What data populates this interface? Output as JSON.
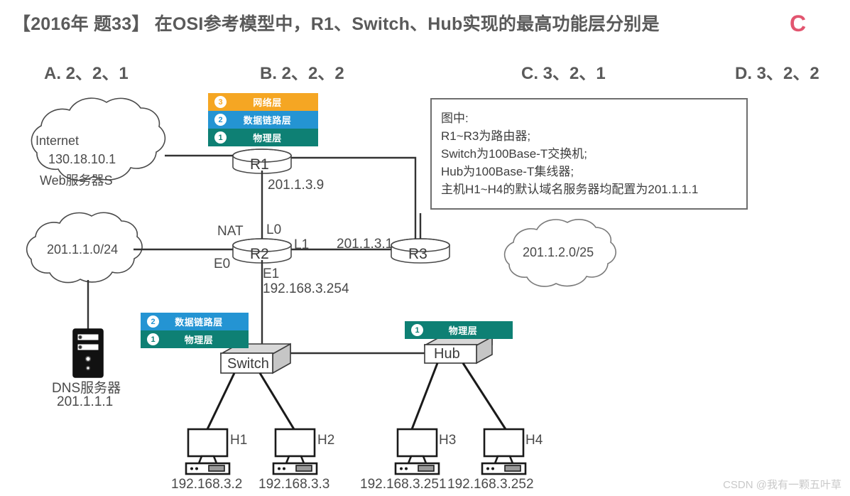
{
  "header": {
    "question": "【2016年 题33】 在OSI参考模型中，R1、Switch、Hub实现的最高功能层分别是",
    "answer_mark": "C",
    "answer_color": "#e2556f",
    "options": [
      {
        "id": "A",
        "text": "A. 2、2、1"
      },
      {
        "id": "B",
        "text": "B. 2、2、2"
      },
      {
        "id": "C",
        "text": "C. 3、2、1"
      },
      {
        "id": "D",
        "text": "D. 3、2、2"
      }
    ]
  },
  "note_box": {
    "lines": [
      "图中:",
      "R1~R3为路由器;",
      "Switch为100Base-T交换机;",
      "Hub为100Base-T集线器;",
      "主机H1~H4的默认域名服务器均配置为201.1.1.1"
    ]
  },
  "layer_stacks": {
    "r1": {
      "device": "R1",
      "rows": [
        {
          "num": "3",
          "label": "网络层",
          "color": "#f5a623"
        },
        {
          "num": "2",
          "label": "数据链路层",
          "color": "#2494d3"
        },
        {
          "num": "1",
          "label": "物理层",
          "color": "#0e8074"
        }
      ]
    },
    "switch": {
      "device": "Switch",
      "rows": [
        {
          "num": "2",
          "label": "数据链路层",
          "color": "#2494d3"
        },
        {
          "num": "1",
          "label": "物理层",
          "color": "#0e8074"
        }
      ]
    },
    "hub": {
      "device": "Hub",
      "rows": [
        {
          "num": "1",
          "label": "物理层",
          "color": "#0e8074"
        }
      ]
    }
  },
  "clouds": {
    "internet": {
      "line1": "Internet",
      "line2": "130.18.10.1",
      "line3": "Web服务器S"
    },
    "lan": {
      "label": "201.1.1.0/24"
    },
    "right": {
      "label": "201.1.2.0/25"
    }
  },
  "routers": {
    "r1": "R1",
    "r2": "R2",
    "r3": "R3"
  },
  "devices": {
    "switch": "Switch",
    "hub": "Hub"
  },
  "dns_server": {
    "name": "DNS服务器",
    "ip": "201.1.1.1"
  },
  "link_labels": {
    "r1_ip": "201.1.3.9",
    "nat": "NAT",
    "l0": "L0",
    "l1": "L1",
    "e0": "E0",
    "e1": "E1",
    "e1_ip": "192.168.3.254",
    "r3_link_ip": "201.1.3.1"
  },
  "hosts": [
    {
      "name": "H1",
      "ip": "192.168.3.2"
    },
    {
      "name": "H2",
      "ip": "192.168.3.3"
    },
    {
      "name": "H3",
      "ip": "192.168.3.251"
    },
    {
      "name": "H4",
      "ip": "192.168.3.252"
    }
  ],
  "watermark": "CSDN @我有一颗五叶草"
}
